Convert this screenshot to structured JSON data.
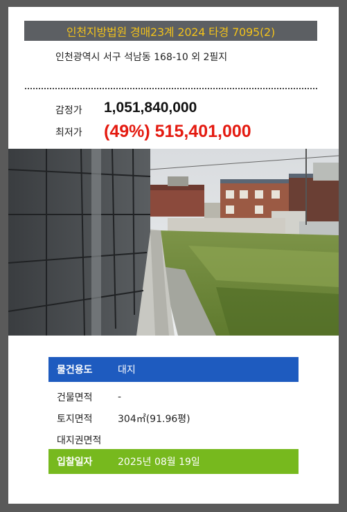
{
  "header": {
    "title": "인천지방법원 경매23계 2024 타경 7095(2)"
  },
  "address": "인천광역시 서구 석남동 168-10 외 2필지",
  "prices": {
    "appraisal_label": "감정가",
    "appraisal_value": "1,051,840,000",
    "min_label": "최저가",
    "min_value": "(49%) 515,401,000"
  },
  "details": {
    "use_label": "물건용도",
    "use_value": "대지",
    "building_area_label": "건물면적",
    "building_area_value": "-",
    "land_area_label": "토지면적",
    "land_area_value": "304㎡(91.96평)",
    "land_right_label": "대지권면적",
    "bid_date_label": "입찰일자",
    "bid_date_value": "2025년 08월 19일"
  },
  "colors": {
    "title_bg": "#5c5f63",
    "title_text": "#f2c21b",
    "min_price": "#e41a10",
    "use_row_bg": "#1e5bbf",
    "bid_row_bg": "#77b91e"
  }
}
